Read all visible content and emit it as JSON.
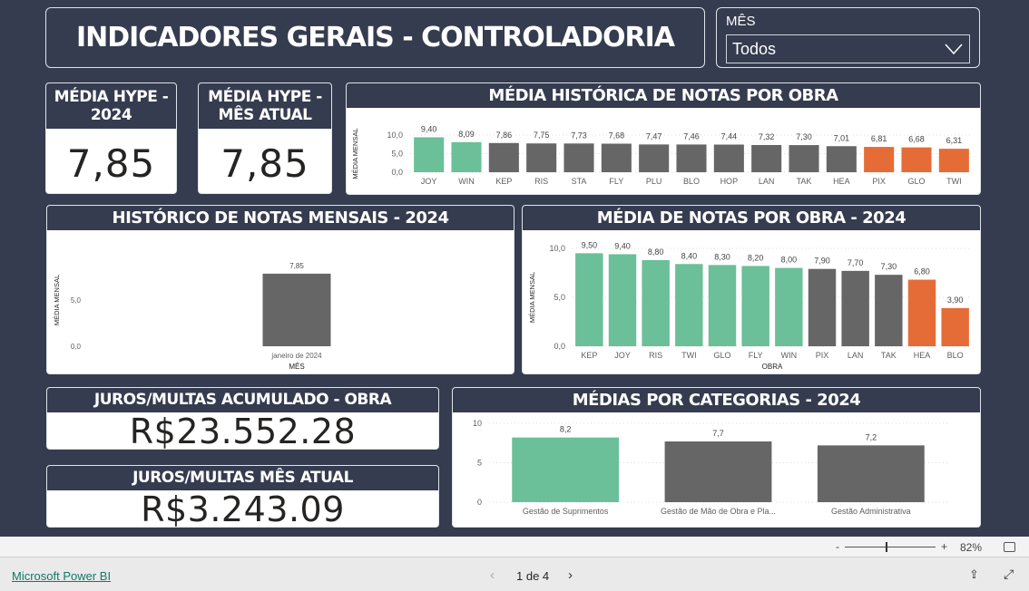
{
  "header": {
    "title": "INDICADORES GERAIS - CONTROLADORIA"
  },
  "filter": {
    "label": "MÊS",
    "value": "Todos"
  },
  "kpis": [
    {
      "title": "MÉDIA HYPE - 2024",
      "value": "7,85"
    },
    {
      "title": "MÉDIA HYPE - MÊS ATUAL",
      "value": "7,85"
    }
  ],
  "juros": [
    {
      "title": "JUROS/MULTAS ACUMULADO - OBRA",
      "value": "R$23.552.28"
    },
    {
      "title": "JUROS/MULTAS MÊS ATUAL",
      "value": "R$3.243.09"
    }
  ],
  "colors": {
    "background": "#353c4f",
    "green": "#6bbf99",
    "gray": "#666666",
    "orange": "#e66c37"
  },
  "chart_data": [
    {
      "id": "hist",
      "type": "bar",
      "title": "MÉDIA HISTÓRICA DE NOTAS POR OBRA",
      "ylabel": "MÉDIA MENSAL",
      "xlabel": "",
      "ylim": [
        0,
        10
      ],
      "yticks": [
        "0,0",
        "5,0",
        "10,0"
      ],
      "grid": true,
      "categories": [
        "JOY",
        "WIN",
        "KEP",
        "RIS",
        "STA",
        "FLY",
        "PLU",
        "BLO",
        "HOP",
        "LAN",
        "TAK",
        "HEA",
        "PIX",
        "GLO",
        "TWI"
      ],
      "values": [
        9.4,
        8.09,
        7.86,
        7.75,
        7.73,
        7.68,
        7.47,
        7.46,
        7.44,
        7.32,
        7.3,
        7.01,
        6.81,
        6.68,
        6.31
      ],
      "labels": [
        "9,40",
        "8,09",
        "7,86",
        "7,75",
        "7,73",
        "7,68",
        "7,47",
        "7,46",
        "7,44",
        "7,32",
        "7,30",
        "7,01",
        "6,81",
        "6,68",
        "6,31"
      ],
      "bar_colors": [
        "green",
        "green",
        "gray",
        "gray",
        "gray",
        "gray",
        "gray",
        "gray",
        "gray",
        "gray",
        "gray",
        "gray",
        "orange",
        "orange",
        "orange"
      ]
    },
    {
      "id": "mensal",
      "type": "bar",
      "title": "HISTÓRICO DE NOTAS MENSAIS - 2024",
      "ylabel": "MÉDIA MENSAL",
      "xlabel": "MÊS",
      "ylim": [
        0,
        10
      ],
      "yticks": [
        "0,0",
        "5,0"
      ],
      "grid": false,
      "categories": [
        "janeiro de 2024"
      ],
      "values": [
        7.85
      ],
      "labels": [
        "7,85"
      ],
      "bar_colors": [
        "gray"
      ]
    },
    {
      "id": "obra2024",
      "type": "bar",
      "title": "MÉDIA DE NOTAS POR OBRA - 2024",
      "ylabel": "MÉDIA MENSAL",
      "xlabel": "OBRA",
      "ylim": [
        0,
        10
      ],
      "yticks": [
        "0,0",
        "5,0",
        "10,0"
      ],
      "grid": true,
      "categories": [
        "KEP",
        "JOY",
        "RIS",
        "TWI",
        "GLO",
        "FLY",
        "WIN",
        "PIX",
        "LAN",
        "TAK",
        "HEA",
        "BLO"
      ],
      "values": [
        9.5,
        9.4,
        8.8,
        8.4,
        8.3,
        8.2,
        8.0,
        7.9,
        7.7,
        7.3,
        6.8,
        3.9
      ],
      "labels": [
        "9,50",
        "9,40",
        "8,80",
        "8,40",
        "8,30",
        "8,20",
        "8,00",
        "7,90",
        "7,70",
        "7,30",
        "6,80",
        "3,90"
      ],
      "bar_colors": [
        "green",
        "green",
        "green",
        "green",
        "green",
        "green",
        "green",
        "gray",
        "gray",
        "gray",
        "orange",
        "orange"
      ]
    },
    {
      "id": "cat",
      "type": "bar",
      "title": "MÉDIAS POR CATEGORIAS - 2024",
      "ylabel": "",
      "xlabel": "",
      "ylim": [
        0,
        10
      ],
      "yticks": [
        "0",
        "5",
        "10"
      ],
      "grid": true,
      "categories": [
        "Gestão de Suprimentos",
        "Gestão de Mão de Obra e Pla...",
        "Gestão Administrativa"
      ],
      "values": [
        8.2,
        7.7,
        7.2
      ],
      "labels": [
        "8,2",
        "7,7",
        "7,2"
      ],
      "bar_colors": [
        "green",
        "gray",
        "gray"
      ]
    }
  ],
  "toolbar": {
    "zoom_minus": "-",
    "zoom_plus": "+",
    "zoom_level": "82%",
    "zoom_fraction": 0.45
  },
  "footer": {
    "brand": "Microsoft Power BI",
    "page": "1 de 4"
  }
}
